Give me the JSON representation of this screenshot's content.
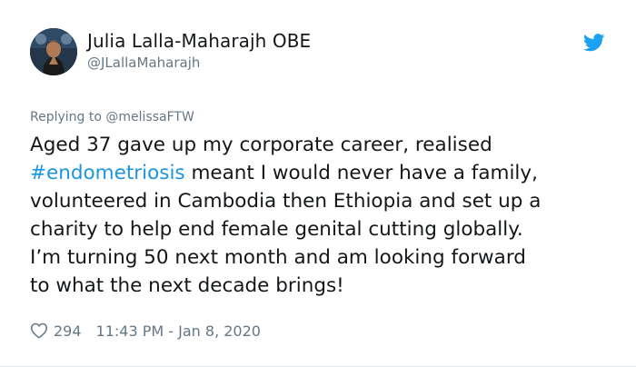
{
  "author": {
    "display_name": "Julia Lalla-Maharajh OBE",
    "handle": "@JLallaMaharajh",
    "avatar_icon": "profile-photo"
  },
  "brand": {
    "icon": "twitter-bird-icon",
    "color": "#1da1f2"
  },
  "reply": {
    "prefix": "Replying to ",
    "to_handle": "@melissaFTW"
  },
  "tweet": {
    "line1": "Aged 37 gave up my corporate career, realised",
    "hashtag": "#endometriosis",
    "line2_rest": " meant I would never have a family,",
    "line3": "volunteered in Cambodia then Ethiopia and set up a",
    "line4": "charity to help end female genital cutting globally.",
    "line5": "I’m turning 50 next month and am looking forward",
    "line6": "to what the next decade brings!"
  },
  "footer": {
    "like_icon": "heart-icon",
    "like_count": "294",
    "timestamp": "11:43 PM - Jan 8, 2020"
  },
  "colors": {
    "text": "#14171a",
    "secondary": "#657786",
    "link": "#1b95e0"
  }
}
